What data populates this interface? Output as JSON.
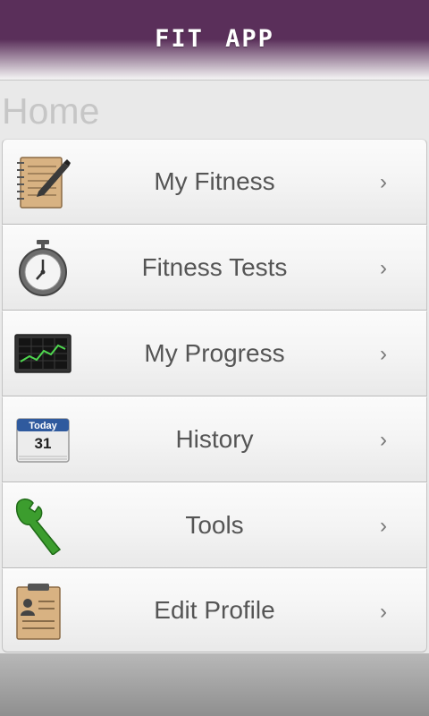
{
  "header": {
    "title": "FIT APP"
  },
  "page": {
    "title": "Home"
  },
  "menu": {
    "items": [
      {
        "label": "My Fitness",
        "icon": "notebook-icon",
        "chevron": "›"
      },
      {
        "label": "Fitness Tests",
        "icon": "stopwatch-icon",
        "chevron": "›"
      },
      {
        "label": "My Progress",
        "icon": "chart-monitor-icon",
        "chevron": "›"
      },
      {
        "label": "History",
        "icon": "calendar-icon",
        "chevron": "›",
        "calendar_top": "Today",
        "calendar_day": "31"
      },
      {
        "label": "Tools",
        "icon": "wrench-icon",
        "chevron": "›"
      },
      {
        "label": "Edit Profile",
        "icon": "profile-clipboard-icon",
        "chevron": "›"
      }
    ]
  },
  "colors": {
    "header": "#5a2f5a",
    "label": "#555555",
    "page_title": "#c6c6c6"
  }
}
